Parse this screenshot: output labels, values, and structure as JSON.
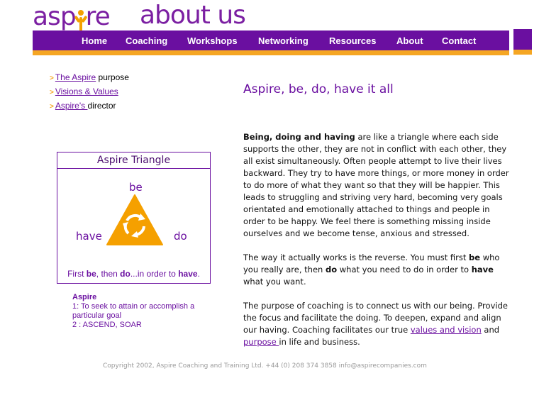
{
  "header": {
    "logo_text_before": "asp",
    "logo_text_after": "re",
    "page_title": "about us"
  },
  "nav": {
    "items": [
      {
        "label": "Home"
      },
      {
        "label": "Coaching"
      },
      {
        "label": "Workshops"
      },
      {
        "label": "Networking"
      },
      {
        "label": "Resources"
      },
      {
        "label": "About"
      },
      {
        "label": "Contact"
      }
    ]
  },
  "colors": {
    "brand_purple": "#6a0fa0",
    "brand_orange": "#f5a623"
  },
  "subnav": {
    "items": [
      {
        "link": "The Aspire",
        "rest": " purpose"
      },
      {
        "link": "Visions & Values",
        "rest": ""
      },
      {
        "link": "Aspire's ",
        "rest": "director"
      }
    ]
  },
  "section_title": "Aspire, be, do, have it all",
  "triangle": {
    "title": "Aspire Triangle",
    "label_be": "be",
    "label_have": "have",
    "label_do": "do",
    "caption_1": "First ",
    "caption_be": "be",
    "caption_2": ", then ",
    "caption_do": "do",
    "caption_3": "...in order to ",
    "caption_have": "have",
    "caption_4": "."
  },
  "definition": {
    "title": "Aspire",
    "line1": "1: To seek to attain or accomplish a particular goal",
    "line2": "2 : ASCEND, SOAR"
  },
  "body": {
    "p1_bold": "Being, doing and having",
    "p1_rest": " are like a triangle where each side supports the other, they are not in conflict with each other, they all exist simultaneously. Often people attempt to live their lives backward. They try to have more things, or more money in order to do more of what they want so that they will be happier. This leads to struggling and striving very hard, becoming very goals orientated and emotionally attached to things and people in order to be happy. We feel there is something missing inside ourselves and we become tense, anxious and stressed.",
    "p2_a": "The way it actually works is the reverse. You must first ",
    "p2_be": "be",
    "p2_b": " who you really are, then ",
    "p2_do": "do",
    "p2_c": " what you need to do in order to ",
    "p2_have": "have",
    "p2_d": " what you want.",
    "p3_a": "The purpose of coaching is to connect us with our being. Provide the focus and facilitate the doing. To deepen, expand and align our having. Coaching facilitates our true ",
    "p3_link1": "values and vision",
    "p3_b": " and ",
    "p3_link2": "purpose ",
    "p3_c": "in life and business."
  },
  "footer": {
    "text": "Copyright 2002, Aspire Coaching and Training Ltd.  +44 (0) 208 374 3858  info@aspirecompanies.com"
  }
}
